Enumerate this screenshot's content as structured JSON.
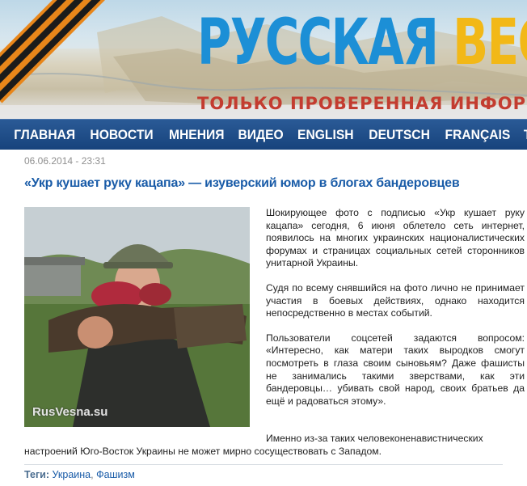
{
  "header": {
    "title_part1": "РУССКАЯ ",
    "title_part2": "ВЕС",
    "slogan": "ТОЛЬКО ПРОВЕРЕННАЯ ИНФОРМ"
  },
  "nav": {
    "items": [
      "ГЛАВНАЯ",
      "НОВОСТИ",
      "МНЕНИЯ",
      "ВИДЕО",
      "ENGLISH",
      "DEUTSCH",
      "FRANÇAIS",
      "ТВ"
    ]
  },
  "article": {
    "date": "06.06.2014 - 23:31",
    "title": "«Укр кушает руку кацапа» — изуверский юмор в блогах бандеровцев",
    "photo_watermark": "RusVesna.su",
    "paragraphs": [
      "Шокирующее фото с подписью «Укр кушает руку кацапа» сегодня, 6 июня облетело сеть интернет, появилось на многих украинских националистических форумах и страницах социальных сетей сторонников унитарной Украины.",
      "Судя по всему снявшийся на фото лично не принимает участия в боевых действиях, однако находится непосредственно в местах событий.",
      "Пользователи соцсетей задаются вопросом: «Интересно, как матери таких выродков смогут посмотреть в глаза своим сыновьям? Даже фашисты не занимались такими зверствами, как эти бандеровцы… убивать свой народ, своих братьев да ещё и радоваться этому»."
    ],
    "last_paragraph_start": "Именно из-за таких человеконенавистнических",
    "last_paragraph_end": "настроений Юго-Восток Украины не может мирно сосуществовать с Западом."
  },
  "tags": {
    "label": "Теги:",
    "items": [
      "Украина",
      "Фашизм"
    ],
    "separator": ", "
  },
  "colors": {
    "brand_blue": "#1c8fd6",
    "brand_yellow": "#f2b817",
    "slogan_red": "#c33c30",
    "nav_bg": "#1f4d88",
    "link": "#1a5ca8"
  }
}
